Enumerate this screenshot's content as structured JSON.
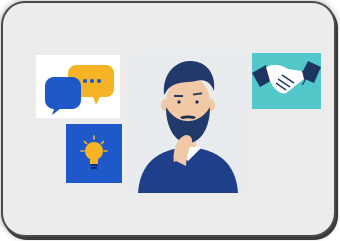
{
  "scene": {
    "frame_color": "#ececec",
    "border_color": "#4a4a4a",
    "panels": [
      {
        "name": "chat-bubbles-panel",
        "icon": "chat-bubbles-icon",
        "bg": "#ffffff",
        "colors": [
          "#1f58c9",
          "#f5b325"
        ]
      },
      {
        "name": "lightbulb-panel",
        "icon": "lightbulb-icon",
        "bg": "#1f58c9",
        "colors": [
          "#f5b325"
        ]
      },
      {
        "name": "thinking-man-panel",
        "icon": "thinking-man-icon",
        "bg": "#e9ecee",
        "colors": [
          "#223a6b",
          "#f2c9a6",
          "#1a2a52"
        ]
      },
      {
        "name": "handshake-panel",
        "icon": "handshake-icon",
        "bg": "#52c8cb",
        "colors": [
          "#1d3560",
          "#ffffff"
        ]
      }
    ]
  }
}
